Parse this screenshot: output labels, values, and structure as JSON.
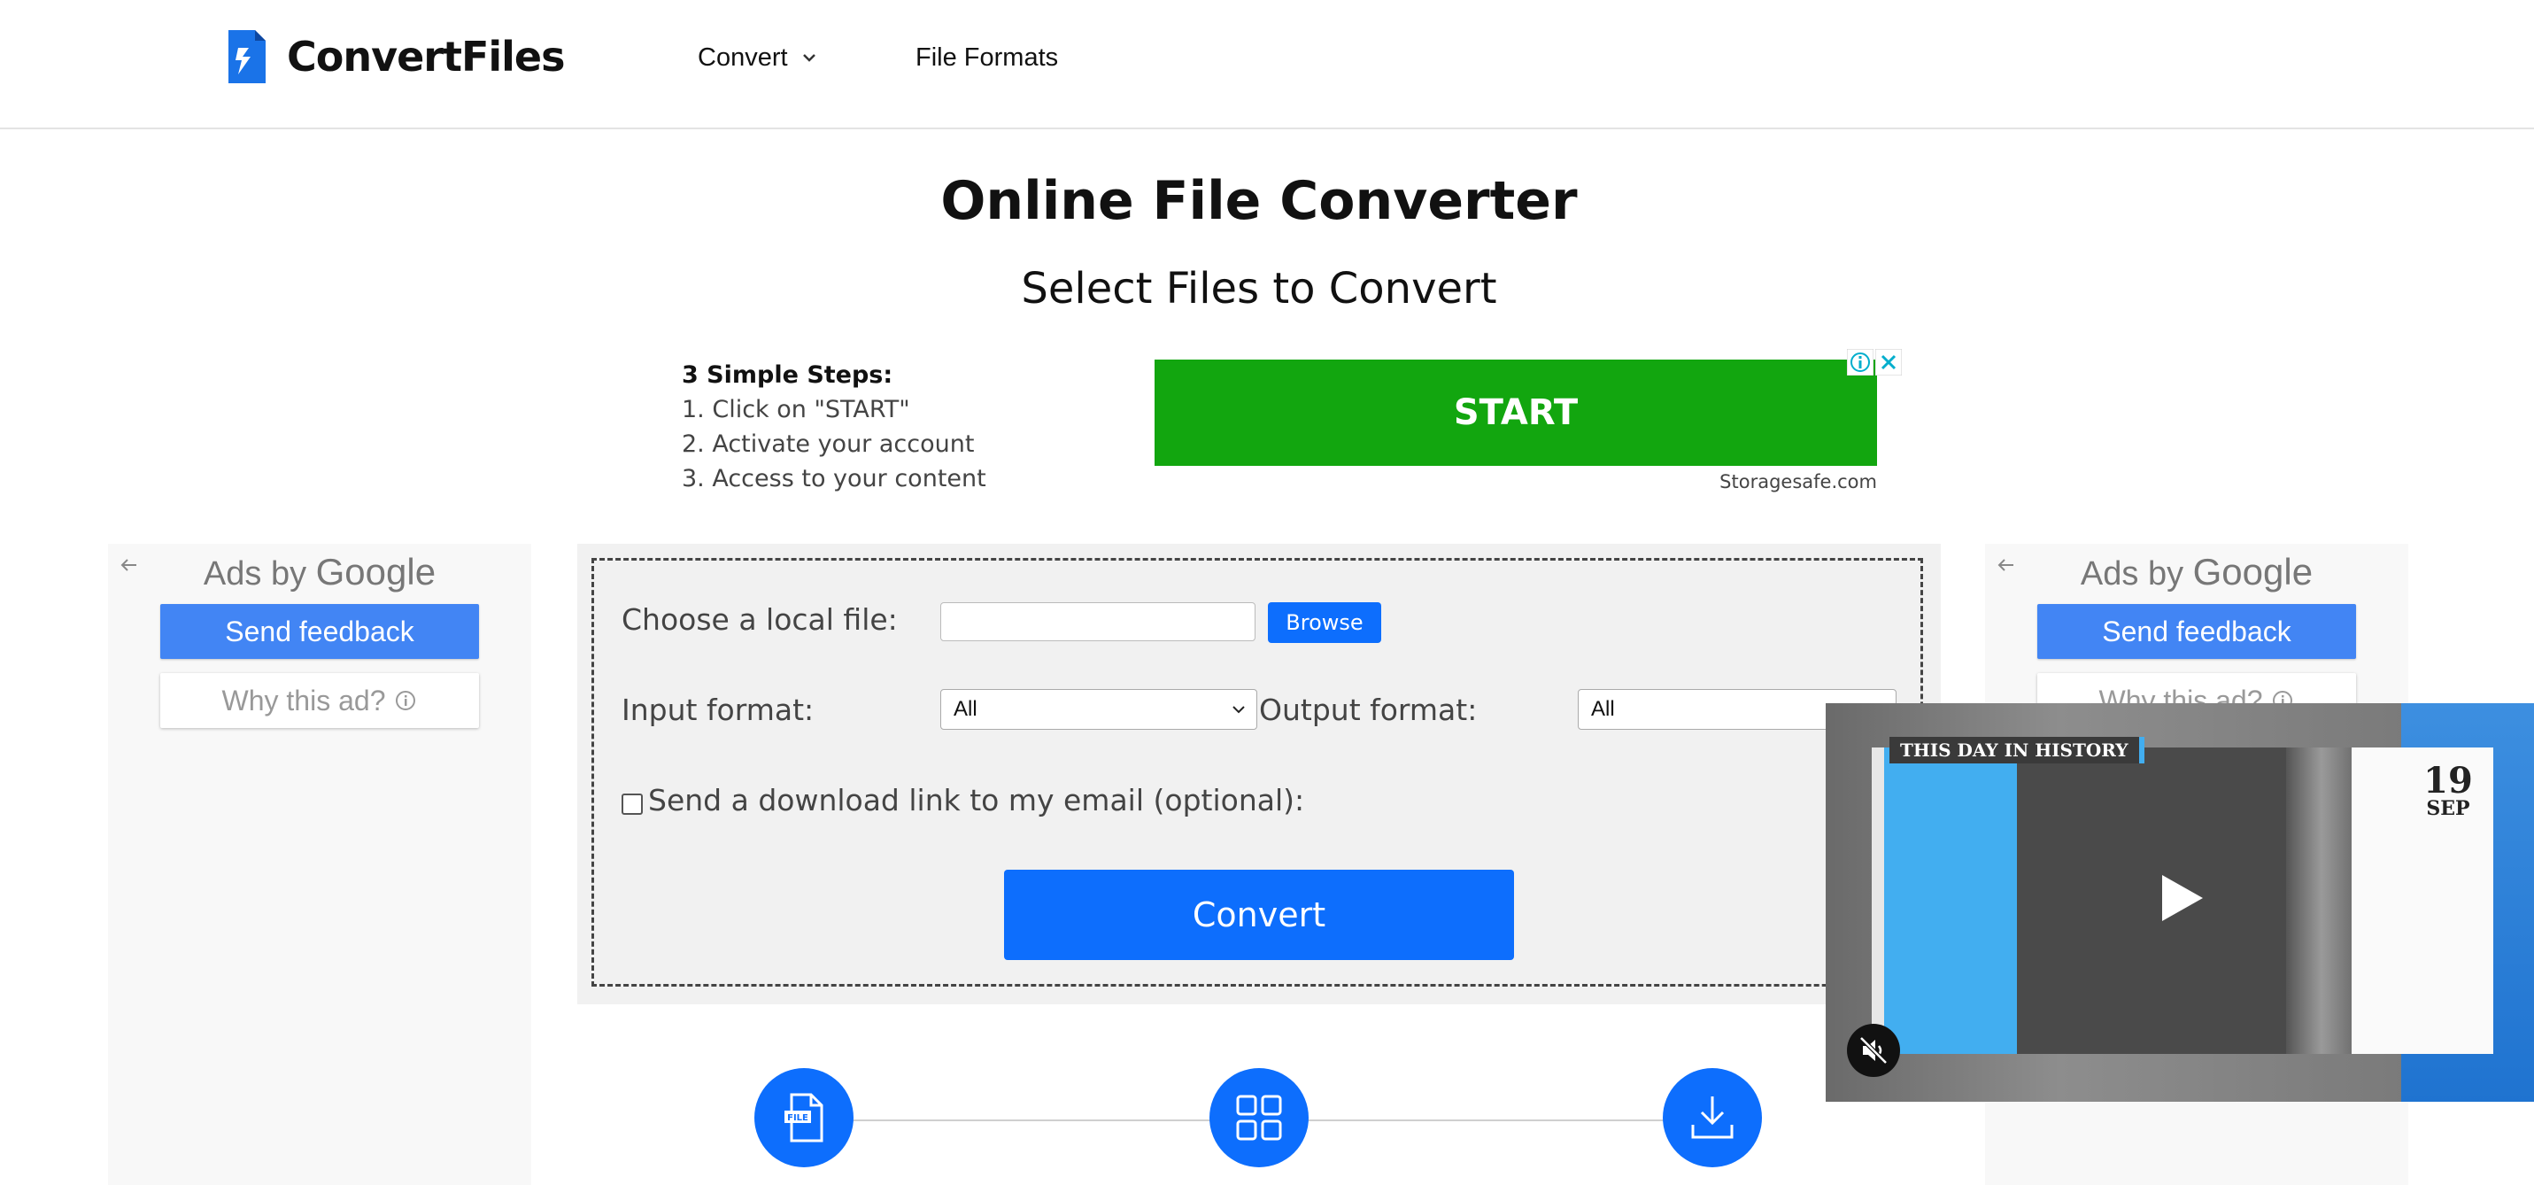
{
  "header": {
    "logo_text": "ConvertFiles",
    "nav": [
      {
        "label": "Convert"
      },
      {
        "label": "File Formats"
      }
    ]
  },
  "main": {
    "title": "Online File Converter",
    "subtitle": "Select Files to Convert"
  },
  "top_ad": {
    "steps_title": "3 Simple Steps:",
    "steps": [
      "1. Click on \"START\"",
      "2. Activate your account",
      "3. Access to your content"
    ],
    "button_label": "START",
    "domain": "Storagesafe.com",
    "button_color": "#12a60f"
  },
  "side_ads": {
    "ads_by": "Ads by",
    "google": "Google",
    "feedback_label": "Send feedback",
    "why_label": "Why this ad?"
  },
  "converter": {
    "file_label": "Choose a local file:",
    "file_value": "",
    "browse_label": "Browse",
    "input_format_label": "Input format:",
    "input_format_value": "All",
    "output_format_label": "Output format:",
    "output_format_value": "All",
    "email_label": "Send a download link to my email (optional):",
    "email_checked": false,
    "convert_label": "Convert",
    "accent_color": "#0d6efd"
  },
  "steps_icons": [
    "file-icon",
    "grid-icon",
    "download-icon"
  ],
  "video": {
    "tag": "THIS DAY IN HISTORY",
    "day": "19",
    "month": "SEP"
  }
}
